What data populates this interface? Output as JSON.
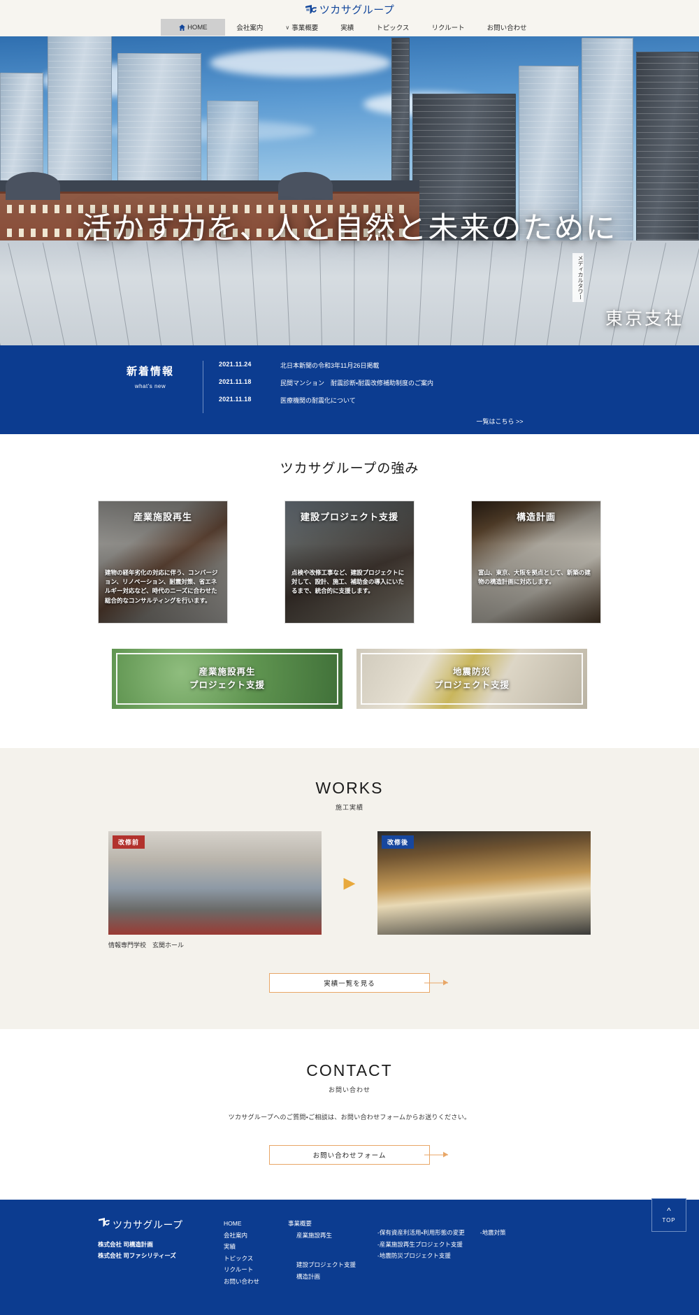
{
  "brand": {
    "name": "ツカサグループ",
    "logo_icon": "tsukasa-mark-icon",
    "accent_blue": "#0c3c90",
    "accent_orange": "#e8a666"
  },
  "nav": {
    "items": [
      {
        "label": "HOME",
        "icon": "home-icon",
        "active": true
      },
      {
        "label": "会社案内",
        "active": false
      },
      {
        "label": "事業概要",
        "caret": "∨",
        "active": false
      },
      {
        "label": "実績",
        "active": false
      },
      {
        "label": "トピックス",
        "active": false
      },
      {
        "label": "リクルート",
        "active": false
      },
      {
        "label": "お問い合わせ",
        "active": false
      }
    ]
  },
  "hero": {
    "title": "活かす力を、人と自然と未来のために",
    "branch_label": "東京支社",
    "vertical_sign": "メディカルタワー"
  },
  "news": {
    "heading_jp": "新着情報",
    "heading_en": "what's new",
    "items": [
      {
        "date": "2021.11.24",
        "title": "北日本新聞の令和3年11月26日掲載"
      },
      {
        "date": "2021.11.18",
        "title": "民間マンション　耐震診断・耐震改修補助制度のご案内"
      },
      {
        "date": "2021.11.18",
        "title": "医療機関の耐震化について"
      }
    ],
    "more_label": "一覧はこちら >>"
  },
  "strengths": {
    "title": "ツカサグループの強み",
    "cards": [
      {
        "title": "産業施設再生",
        "body": "建物の経年劣化の対応に伴う、コンバージョン、リノベーション、耐震対策、省エネルギー対応など、時代のニーズに合わせた総合的なコンサルティングを行います。"
      },
      {
        "title": "建設プロジェクト支援",
        "body": "点検や改修工事など、建設プロジェクトに対して、設計、施工、補助金の導入にいたるまで、統合的に支援します。"
      },
      {
        "title": "構造計画",
        "body": "富山、東京、大阪を拠点として、新築の建物の構造計画に対応します。"
      }
    ],
    "banners": [
      {
        "line1": "産業施設再生",
        "line2": "プロジェクト支援"
      },
      {
        "line1": "地震防災",
        "line2": "プロジェクト支援"
      }
    ]
  },
  "works": {
    "title_en": "WORKS",
    "title_jp": "施工実績",
    "badge_before": "改修前",
    "badge_after": "改修後",
    "arrow_icon": "triangle-right-icon",
    "caption": "情報専門学校　玄関ホール",
    "button_label": "実績一覧を見る"
  },
  "contact": {
    "title_en": "CONTACT",
    "title_jp": "お問い合わせ",
    "description": "ツカサグループへのご質問・ご相談は、お問い合わせフォームからお送りください。",
    "button_label": "お問い合わせフォーム"
  },
  "footer": {
    "brand_name": "ツカサグループ",
    "companies": [
      "株式会社 司構造計画",
      "株式会社 司ファシリティーズ"
    ],
    "col_a": [
      "HOME",
      "会社案内",
      "実績",
      "トピックス",
      "リクルート",
      "お問い合わせ"
    ],
    "col_b_heading": "事業概要",
    "col_b_sub1": "産業施設再生",
    "col_b_sub2": "建設プロジェクト支援",
    "col_b_sub3": "構造計画",
    "col_c_row1_a": "-保有資産利活用・利用形態の変更",
    "col_c_row1_b": "-地震対策",
    "col_c_row2": "-産業施設再生プロジェクト支援",
    "col_c_row3": "-地震防災プロジェクト支援",
    "to_top_label": "TOP",
    "to_top_icon": "chevron-up-icon"
  }
}
